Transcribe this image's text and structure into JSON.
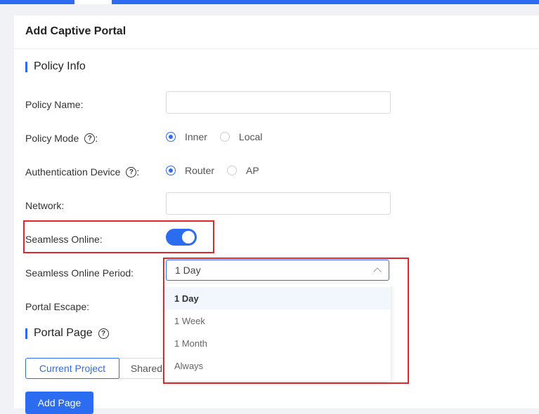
{
  "page": {
    "title": "Add Captive Portal"
  },
  "policy_info": {
    "title": "Policy Info",
    "policy_name_label": "Policy Name:",
    "policy_name_value": "",
    "policy_mode_label": "Policy Mode",
    "policy_mode_suffix": ":",
    "policy_mode_options": [
      "Inner",
      "Local"
    ],
    "policy_mode_selected": "Inner",
    "auth_device_label": "Authentication Device",
    "auth_device_suffix": ":",
    "auth_device_options": [
      "Router",
      "AP"
    ],
    "auth_device_selected": "Router",
    "network_label": "Network:",
    "network_value": "",
    "seamless_online_label": "Seamless Online:",
    "seamless_online_enabled": true,
    "seamless_period_label": "Seamless Online Period:",
    "seamless_period_value": "1 Day",
    "seamless_period_options": [
      "1 Day",
      "1 Week",
      "1 Month",
      "Always"
    ],
    "portal_escape_label": "Portal Escape:"
  },
  "portal_page": {
    "title": "Portal Page",
    "tabs": [
      "Current Project",
      "Shared"
    ],
    "active_tab": "Current Project",
    "add_page_label": "Add Page"
  },
  "icons": {
    "help": "question-circle-icon",
    "help_glyph": "?",
    "chevron": "chevron-up-icon"
  },
  "colors": {
    "accent": "#2b6cf0",
    "highlight": "#e0262b"
  }
}
